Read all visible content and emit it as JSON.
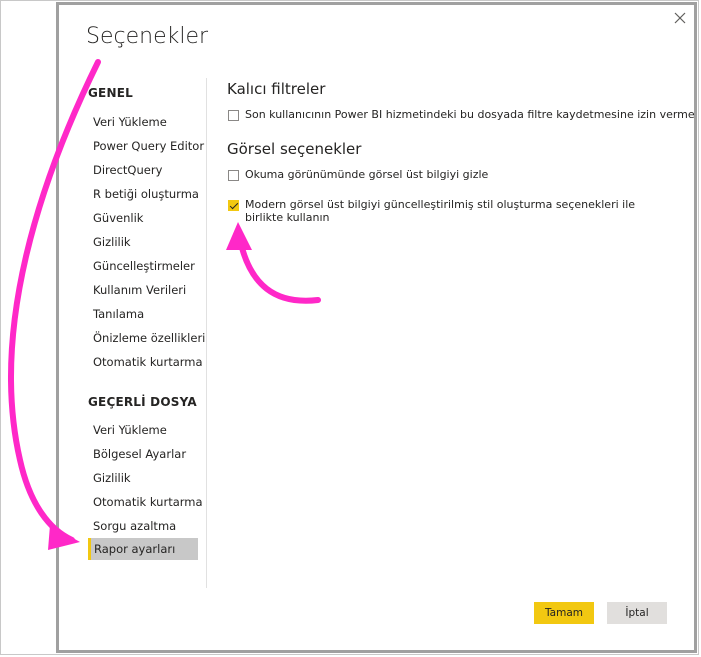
{
  "dialog": {
    "title": "Seçenekler",
    "close_glyph": "✕"
  },
  "sidebar": {
    "global_header": "GENEL",
    "global_items": [
      "Veri Yükleme",
      "Power Query Editor",
      "DirectQuery",
      "R betiği oluşturma",
      "Güvenlik",
      "Gizlilik",
      "Güncelleştirmeler",
      "Kullanım Verileri",
      "Tanılama",
      "Önizleme özellikleri",
      "Otomatik kurtarma"
    ],
    "file_header": "GEÇERLİ DOSYA",
    "file_items": [
      "Veri Yükleme",
      "Bölgesel Ayarlar",
      "Gizlilik",
      "Otomatik kurtarma",
      "Sorgu azaltma",
      "Rapor ayarları"
    ],
    "selected_item": "Rapor ayarları"
  },
  "content": {
    "persistent_filters_heading": "Kalıcı filtreler",
    "persistent_filters_option": {
      "label": "Son kullanıcının Power BI hizmetindeki bu dosyada filtre kaydetmesine izin verme",
      "checked": false
    },
    "visual_options_heading": "Görsel seçenekler",
    "visual_option_1": {
      "label": "Okuma görünümünde görsel üst bilgiyi gizle",
      "checked": false
    },
    "visual_option_2": {
      "label": "Modern görsel üst bilgiyi güncelleştirilmiş stil oluşturma seçenekleri ile birlikte kullanın",
      "checked": true
    }
  },
  "footer": {
    "ok_label": "Tamam",
    "cancel_label": "İptal"
  },
  "colors": {
    "accent": "#f2c811",
    "annotation_arrow": "#ff28c8",
    "selected_bg": "#c8c8c8",
    "cancel_bg": "#e1dfdd"
  },
  "icons": {
    "close": "close-icon",
    "checkmark": "checkmark-icon",
    "annotation_arrows": "curved-arrow-icon"
  }
}
